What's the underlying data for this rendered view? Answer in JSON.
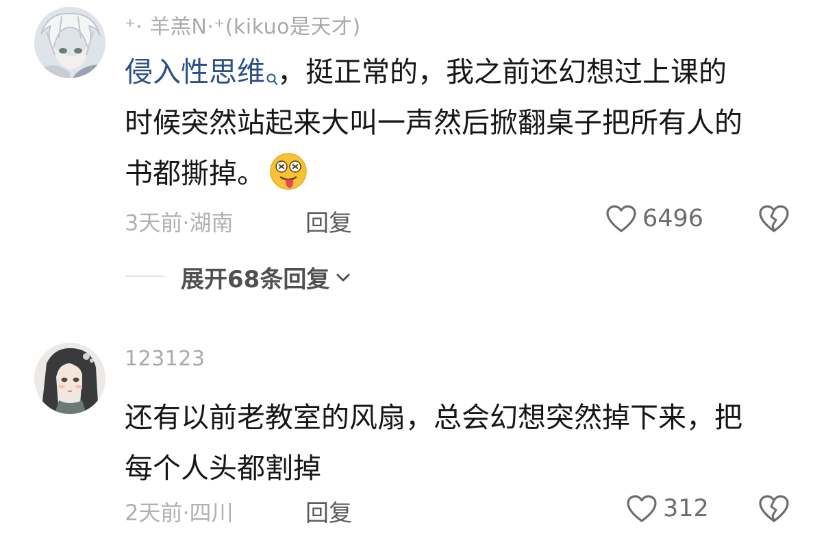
{
  "comments": [
    {
      "username": "⁺· 羊羔N·⁺(kikuo是天才)",
      "keyword": "侵入性思维",
      "body_line1_rest": "，挺正常的，我之前还幻想过上课的",
      "body_line2": "时候突然站起来大叫一声然后掀翻桌子把所有人的",
      "body_line3": "书都撕掉。",
      "emoji": "tongue-out-dizzy-face-emoji",
      "time": "3天前·湖南",
      "reply_label": "回复",
      "likes": "6496",
      "expand_label": "展开68条回复"
    },
    {
      "username": "123123",
      "body_line1": "还有以前老教室的风扇，总会幻想突然掉下来，把",
      "body_line2": "每个人头都割掉",
      "time": "2天前·四川",
      "reply_label": "回复",
      "likes": "312"
    }
  ],
  "colors": {
    "keyword": "#2c4f86",
    "username": "#a9a9a9",
    "body_text": "#161616",
    "meta": "#b0b0b0"
  }
}
